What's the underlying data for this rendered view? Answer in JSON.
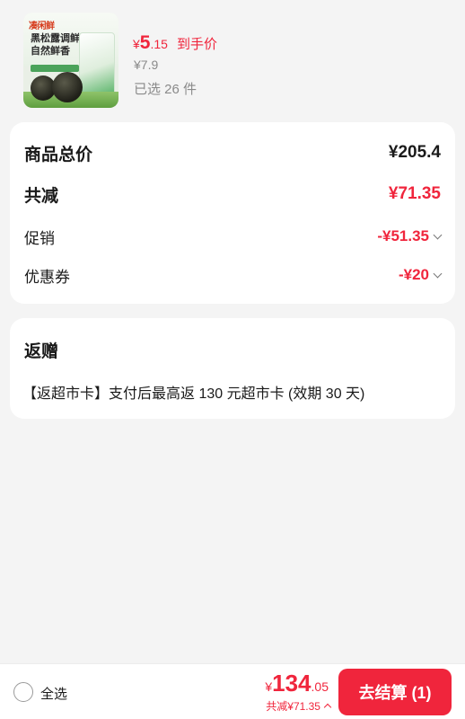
{
  "product": {
    "image_texts": {
      "logo": "凑闲鲜",
      "line1": "黑松露调鲜",
      "line2": "自然鲜香"
    },
    "price_symbol": "¥",
    "price_int": "5",
    "price_dec": ".15",
    "price_label": "到手价",
    "original_price": "¥7.9",
    "selected": "已选 26 件"
  },
  "summary": {
    "total_label": "商品总价",
    "total_value": "¥205.4",
    "discount_label": "共减",
    "discount_value": "¥71.35",
    "promo_label": "促销",
    "promo_value": "-¥51.35",
    "coupon_label": "优惠券",
    "coupon_value": "-¥20"
  },
  "gift": {
    "title": "返赠",
    "desc": "【返超市卡】支付后最高返 130 元超市卡 (效期 30 天)"
  },
  "bottom": {
    "select_all": "全选",
    "total_symbol": "¥",
    "total_int": "134",
    "total_dec": ".05",
    "saved_text": "共减¥71.35",
    "checkout_label": "去结算 (1)"
  },
  "colors": {
    "accent": "#f0253c",
    "background": "#f4f4f4"
  }
}
